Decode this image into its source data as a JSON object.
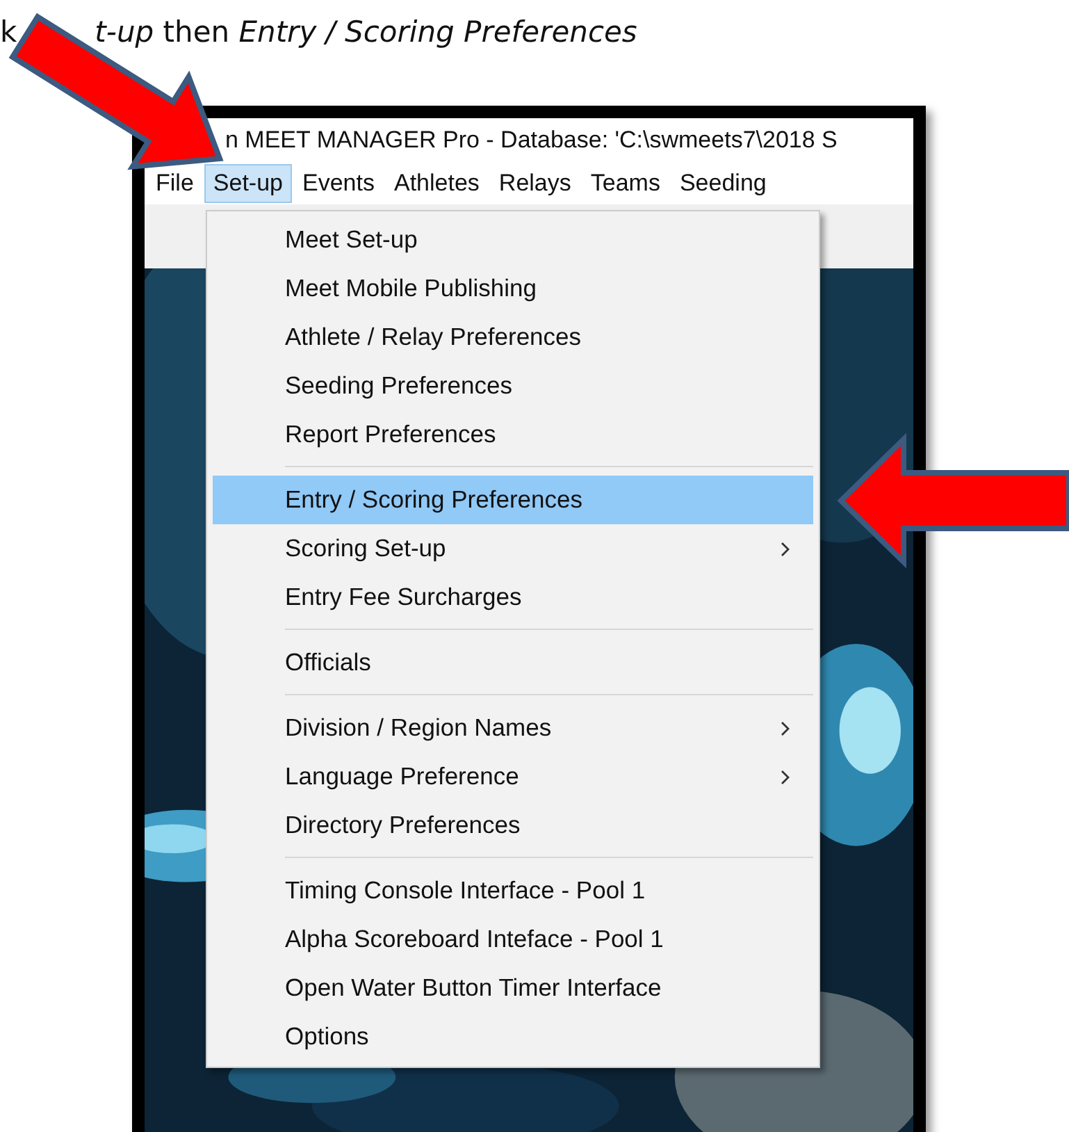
{
  "caption": {
    "lead": "k",
    "text": "*t-up* then *Entry / Scoring Preferences*"
  },
  "window": {
    "title": "n MEET MANAGER Pro - Database: 'C:\\swmeets7\\2018 S"
  },
  "menubar": [
    {
      "label": "File",
      "selected": false
    },
    {
      "label": "Set-up",
      "selected": true
    },
    {
      "label": "Events",
      "selected": false
    },
    {
      "label": "Athletes",
      "selected": false
    },
    {
      "label": "Relays",
      "selected": false
    },
    {
      "label": "Teams",
      "selected": false
    },
    {
      "label": "Seeding",
      "selected": false
    }
  ],
  "menu": [
    {
      "kind": "item",
      "label": "Meet Set-up",
      "submenu": false,
      "selected": false
    },
    {
      "kind": "item",
      "label": "Meet Mobile Publishing",
      "submenu": false,
      "selected": false
    },
    {
      "kind": "item",
      "label": "Athlete / Relay Preferences",
      "submenu": false,
      "selected": false
    },
    {
      "kind": "item",
      "label": "Seeding Preferences",
      "submenu": false,
      "selected": false
    },
    {
      "kind": "item",
      "label": "Report Preferences",
      "submenu": false,
      "selected": false
    },
    {
      "kind": "separator"
    },
    {
      "kind": "item",
      "label": "Entry / Scoring Preferences",
      "submenu": false,
      "selected": true
    },
    {
      "kind": "item",
      "label": "Scoring Set-up",
      "submenu": true,
      "selected": false
    },
    {
      "kind": "item",
      "label": "Entry Fee Surcharges",
      "submenu": false,
      "selected": false
    },
    {
      "kind": "separator"
    },
    {
      "kind": "item",
      "label": "Officials",
      "submenu": false,
      "selected": false
    },
    {
      "kind": "separator"
    },
    {
      "kind": "item",
      "label": "Division / Region Names",
      "submenu": true,
      "selected": false
    },
    {
      "kind": "item",
      "label": "Language Preference",
      "submenu": true,
      "selected": false
    },
    {
      "kind": "item",
      "label": "Directory Preferences",
      "submenu": false,
      "selected": false
    },
    {
      "kind": "separator"
    },
    {
      "kind": "item",
      "label": "Timing Console Interface - Pool 1",
      "submenu": false,
      "selected": false
    },
    {
      "kind": "item",
      "label": "Alpha Scoreboard Inteface - Pool 1",
      "submenu": false,
      "selected": false
    },
    {
      "kind": "item",
      "label": "Open Water Button Timer Interface",
      "submenu": false,
      "selected": false
    },
    {
      "kind": "item",
      "label": "Options",
      "submenu": false,
      "selected": false
    }
  ]
}
